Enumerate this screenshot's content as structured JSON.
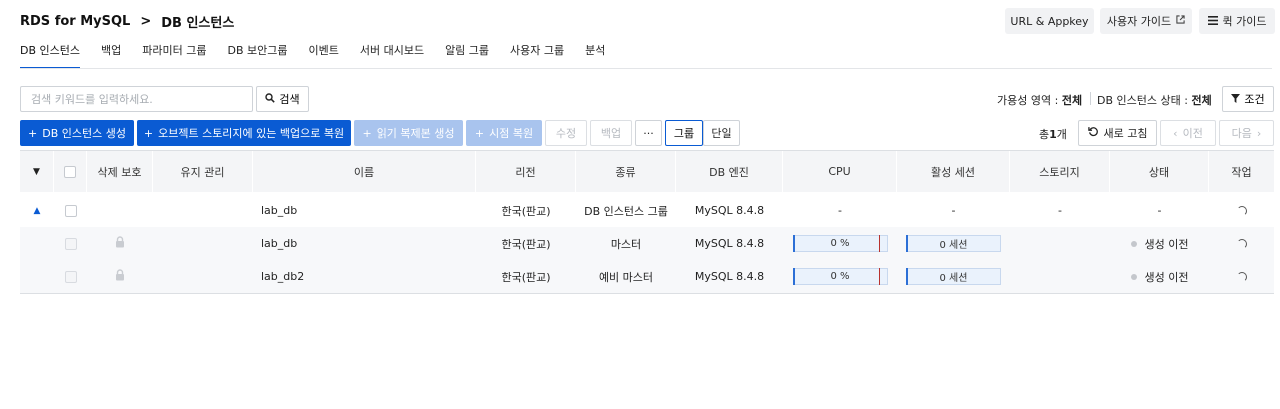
{
  "breadcrumb": {
    "service": "RDS for MySQL",
    "separator": ">",
    "page": "DB 인스턴스"
  },
  "header_buttons": {
    "url_appkey": "URL & Appkey",
    "user_guide": "사용자 가이드",
    "quick_guide": "퀵 가이드"
  },
  "tabs": [
    {
      "label": "DB 인스턴스",
      "active": true
    },
    {
      "label": "백업"
    },
    {
      "label": "파라미터 그룹"
    },
    {
      "label": "DB 보안그룹"
    },
    {
      "label": "이벤트"
    },
    {
      "label": "서버 대시보드"
    },
    {
      "label": "알림 그룹"
    },
    {
      "label": "사용자 그룹"
    },
    {
      "label": "분석"
    }
  ],
  "search": {
    "placeholder": "검색 키워드를 입력하세요.",
    "value": "",
    "button_label": "검색"
  },
  "filters": {
    "availability_zone_label": "가용성 영역",
    "availability_zone_value": "전체",
    "instance_status_label": "DB 인스턴스 상태",
    "instance_status_value": "전체",
    "colon": ":",
    "condition_button": "조건"
  },
  "actions": {
    "create_instance": "DB 인스턴스 생성",
    "restore_from_object_storage": "오브젝트 스토리지에 있는 백업으로 복원",
    "create_read_replica": "읽기 복제본 생성",
    "point_in_time_restore": "시점 복원",
    "modify": "수정",
    "backup": "백업",
    "more": "···",
    "view_group": "그룹",
    "view_single": "단일",
    "total_prefix": "총",
    "total_count": "1",
    "total_suffix": "개",
    "refresh": "새로 고침",
    "prev": "이전",
    "next": "다음"
  },
  "table": {
    "headers": {
      "delete_protection": "삭제 보호",
      "maintenance": "유지 관리",
      "name": "이름",
      "region": "리전",
      "type": "종류",
      "db_engine": "DB 엔진",
      "cpu": "CPU",
      "active_sessions": "활성 세션",
      "storage": "스토리지",
      "status": "상태",
      "task": "작업"
    },
    "rows": [
      {
        "name": "lab_db",
        "region": "한국(판교)",
        "type": "DB 인스턴스 그룹",
        "engine": "MySQL 8.4.8",
        "cpu": "-",
        "sessions": "-",
        "storage": "-",
        "status": "-"
      },
      {
        "name": "lab_db",
        "region": "한국(판교)",
        "type": "마스터",
        "engine": "MySQL 8.4.8",
        "cpu": "0 %",
        "sessions": "0 세션",
        "storage": "",
        "status": "생성 이전"
      },
      {
        "name": "lab_db2",
        "region": "한국(판교)",
        "type": "예비 마스터",
        "engine": "MySQL 8.4.8",
        "cpu": "0 %",
        "sessions": "0 세션",
        "storage": "",
        "status": "생성 이전"
      }
    ]
  },
  "colors": {
    "primary": "#0a5bd3",
    "primary_disabled": "#a9c4ee",
    "header_bg": "#f4f5f7",
    "bar_bg": "#eaf2fc",
    "bar_limit": "#b8322e"
  }
}
